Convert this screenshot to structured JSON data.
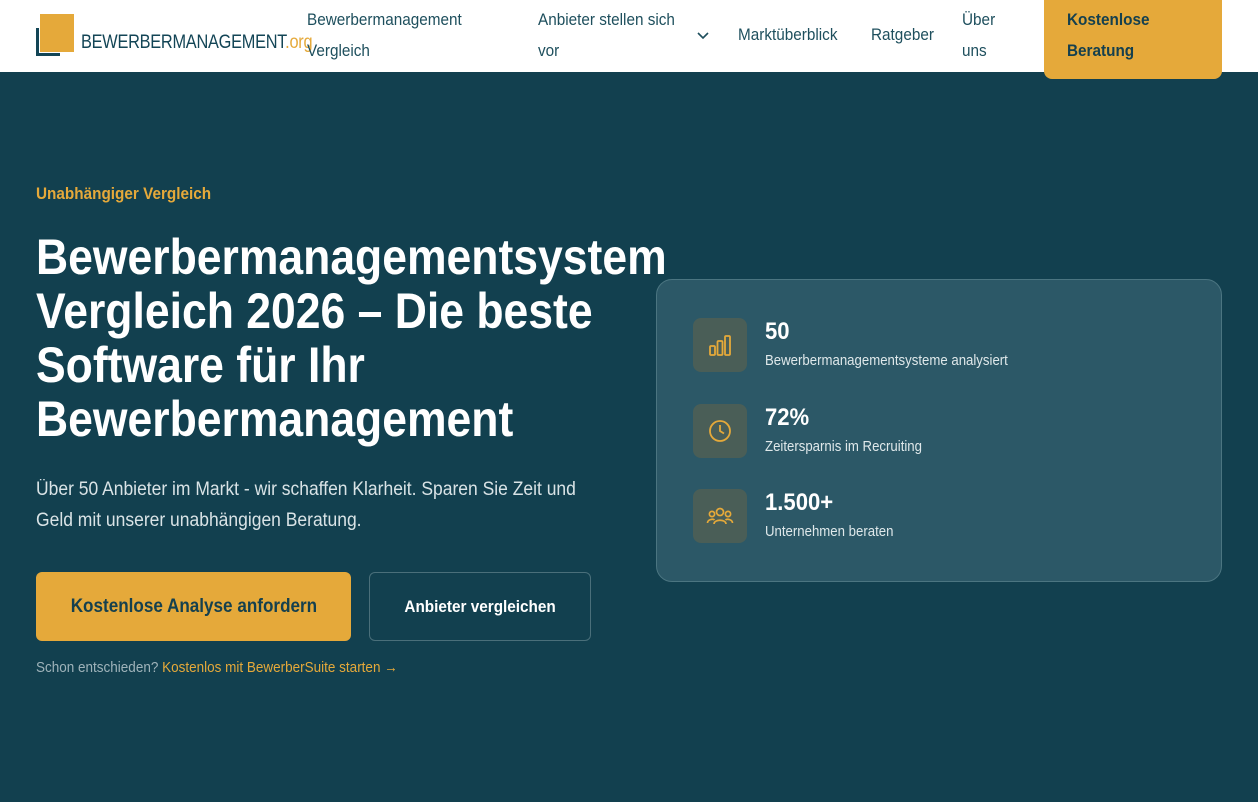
{
  "header": {
    "logo_text": "BEWERBERMANAGEMENT",
    "logo_tld": ".org",
    "nav": [
      {
        "line1": "Bewerbermanagement",
        "line2": "Vergleich"
      },
      {
        "line1": "Anbieter stellen sich",
        "line2": "vor"
      },
      {
        "line1": "Marktüberblick"
      },
      {
        "line1": "Ratgeber"
      },
      {
        "line1": "Über",
        "line2": "uns"
      }
    ],
    "cta": {
      "line1": "Kostenlose",
      "line2": "Beratung"
    }
  },
  "hero": {
    "eyebrow": "Unabhängiger Vergleich",
    "title": "Bewerbermanagementsystem Vergleich 2026 – Die beste Software für Ihr Bewerbermanagement",
    "subtitle": "Über 50 Anbieter im Markt - wir schaffen Klarheit. Sparen Sie Zeit und Geld mit unserer unabhängigen Beratung.",
    "primary_button": "Kostenlose Analyse anfordern",
    "secondary_button": "Anbieter vergleichen",
    "decided_text": "Schon entschieden?",
    "decided_link": "Kostenlos mit BewerberSuite starten →"
  },
  "stats": [
    {
      "icon": "bar-chart-icon",
      "value": "50",
      "label": "Bewerbermanagementsysteme analysiert"
    },
    {
      "icon": "clock-icon",
      "value": "72%",
      "label": "Zeitersparnis im Recruiting"
    },
    {
      "icon": "users-icon",
      "value": "1.500+",
      "label": "Unternehmen beraten"
    }
  ],
  "colors": {
    "background": "#12404f",
    "accent": "#e5a93a",
    "brand": "#134556"
  }
}
